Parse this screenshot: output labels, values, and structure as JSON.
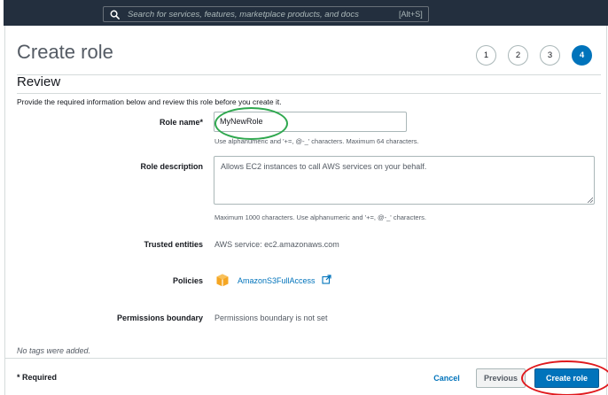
{
  "search": {
    "placeholder": "Search for services, features, marketplace products, and docs",
    "shortcut": "[Alt+S]"
  },
  "page": {
    "title": "Create role",
    "steps": [
      "1",
      "2",
      "3",
      "4"
    ],
    "active_step": 4,
    "section_title": "Review",
    "intro": "Provide the required information below and review this role before you create it."
  },
  "form": {
    "role_name_label": "Role name*",
    "role_name_value": "MyNewRole",
    "role_name_hint": "Use alphanumeric and '+=, @-_' characters. Maximum 64 characters.",
    "role_description_label": "Role description",
    "role_description_value": "Allows EC2 instances to call AWS services on your behalf.",
    "role_description_hint": "Maximum 1000 characters. Use alphanumeric and '+=, @-_' characters.",
    "trusted_entities_label": "Trusted entities",
    "trusted_entities_value": "AWS service: ec2.amazonaws.com",
    "policies_label": "Policies",
    "policy_name": "AmazonS3FullAccess",
    "permissions_boundary_label": "Permissions boundary",
    "permissions_boundary_value": "Permissions boundary is not set",
    "no_tags": "No tags were added."
  },
  "footer": {
    "required_note": "* Required",
    "cancel_label": "Cancel",
    "previous_label": "Previous",
    "create_label": "Create role"
  },
  "colors": {
    "topbar": "#232f3e",
    "primary": "#0073bb",
    "highlight_green": "#2fa84f",
    "highlight_red": "#e0191d",
    "policy_icon": "#f5a623"
  },
  "icons": {
    "search": "search-icon",
    "policy": "policy-package-icon",
    "external": "external-link-icon"
  }
}
